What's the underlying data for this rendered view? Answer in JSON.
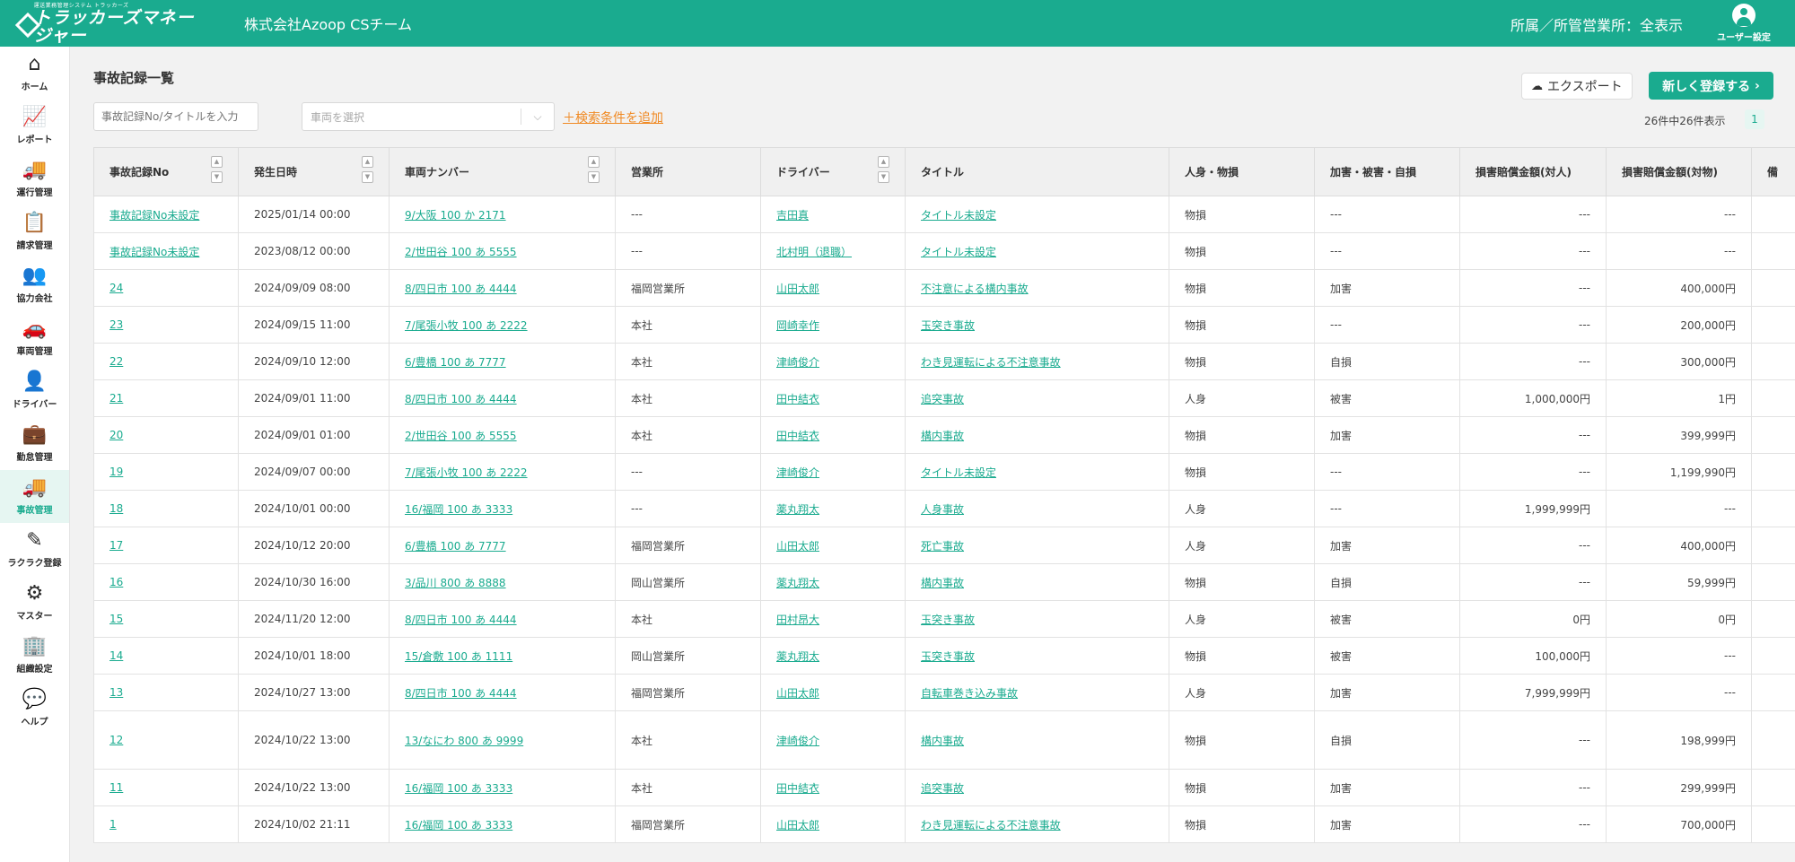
{
  "header": {
    "logo_tag": "運送業務管理システム トラッカーズ",
    "logo_name": "トラッカーズマネージャー",
    "company": "株式会社Azoop CSチーム",
    "affiliation": "所属／所管営業所：全表示",
    "user_settings": "ユーザー設定"
  },
  "sidebar": {
    "items": [
      {
        "label": "ホーム",
        "icon": "⌂",
        "icon_name": "home-icon"
      },
      {
        "label": "レポート",
        "icon": "📈",
        "icon_name": "chart-line-icon"
      },
      {
        "label": "運行管理",
        "icon": "🚚",
        "icon_name": "truck-icon"
      },
      {
        "label": "請求管理",
        "icon": "📋",
        "icon_name": "clipboard-icon"
      },
      {
        "label": "協力会社",
        "icon": "👥",
        "icon_name": "people-icon"
      },
      {
        "label": "車両管理",
        "icon": "🚗",
        "icon_name": "car-icon"
      },
      {
        "label": "ドライバー",
        "icon": "👤",
        "icon_name": "person-icon"
      },
      {
        "label": "勤怠管理",
        "icon": "💼",
        "icon_name": "briefcase-clock-icon"
      },
      {
        "label": "事故管理",
        "icon": "🚚",
        "icon_name": "truck-accident-icon",
        "active": true
      },
      {
        "label": "ラクラク登録",
        "icon": "✎",
        "icon_name": "pencil-icon"
      },
      {
        "label": "マスター",
        "icon": "⚙",
        "icon_name": "gear-icon"
      },
      {
        "label": "組織設定",
        "icon": "🏢",
        "icon_name": "building-icon"
      },
      {
        "label": "ヘルプ",
        "icon": "💬",
        "icon_name": "chat-icon"
      }
    ]
  },
  "main": {
    "title": "事故記録一覧",
    "search_placeholder": "事故記録No/タイトルを入力",
    "vehicle_placeholder": "車両を選択",
    "add_condition": "＋検索条件を追加",
    "export_label": "エクスポート",
    "register_label": "新しく登録する",
    "count_text": "26件中26件表示",
    "page": "1"
  },
  "table": {
    "headers": [
      "事故記録No",
      "発生日時",
      "車両ナンバー",
      "営業所",
      "ドライバー",
      "タイトル",
      "人身・物損",
      "加害・被害・自損",
      "損害賠償金額(対人)",
      "損害賠償金額(対物)",
      "備"
    ],
    "rows": [
      {
        "no": "事故記録No未設定",
        "date": "2025/01/14 00:00",
        "vehicle": "9/大阪 100 か 2171",
        "office": "---",
        "driver": "吉田真",
        "title": "タイトル未設定",
        "kind": "物損",
        "party": "---",
        "personal": "---",
        "property": "---"
      },
      {
        "no": "事故記録No未設定",
        "date": "2023/08/12 00:00",
        "vehicle": "2/世田谷 100 あ 5555",
        "office": "---",
        "driver": "北村明（退職）",
        "title": "タイトル未設定",
        "kind": "物損",
        "party": "---",
        "personal": "---",
        "property": "---"
      },
      {
        "no": "24",
        "date": "2024/09/09 08:00",
        "vehicle": "8/四日市 100 あ 4444",
        "office": "福岡営業所",
        "driver": "山田太郎",
        "title": "不注意による構内事故",
        "kind": "物損",
        "party": "加害",
        "personal": "---",
        "property": "400,000円"
      },
      {
        "no": "23",
        "date": "2024/09/15 11:00",
        "vehicle": "7/尾張小牧 100 あ 2222",
        "office": "本社",
        "driver": "岡崎幸作",
        "title": "玉突き事故",
        "kind": "物損",
        "party": "---",
        "personal": "---",
        "property": "200,000円"
      },
      {
        "no": "22",
        "date": "2024/09/10 12:00",
        "vehicle": "6/豊橋 100 あ 7777",
        "office": "本社",
        "driver": "津崎俊介",
        "title": "わき見運転による不注意事故",
        "kind": "物損",
        "party": "自損",
        "personal": "---",
        "property": "300,000円"
      },
      {
        "no": "21",
        "date": "2024/09/01 11:00",
        "vehicle": "8/四日市 100 あ 4444",
        "office": "本社",
        "driver": "田中結衣",
        "title": "追突事故",
        "kind": "人身",
        "party": "被害",
        "personal": "1,000,000円",
        "property": "1円"
      },
      {
        "no": "20",
        "date": "2024/09/01 01:00",
        "vehicle": "2/世田谷 100 あ 5555",
        "office": "本社",
        "driver": "田中結衣",
        "title": "構内事故",
        "kind": "物損",
        "party": "加害",
        "personal": "---",
        "property": "399,999円"
      },
      {
        "no": "19",
        "date": "2024/09/07 00:00",
        "vehicle": "7/尾張小牧 100 あ 2222",
        "office": "---",
        "driver": "津崎俊介",
        "title": "タイトル未設定",
        "kind": "物損",
        "party": "---",
        "personal": "---",
        "property": "1,199,990円"
      },
      {
        "no": "18",
        "date": "2024/10/01 00:00",
        "vehicle": "16/福岡 100 あ 3333",
        "office": "---",
        "driver": "薬丸翔太",
        "title": "人身事故",
        "kind": "人身",
        "party": "---",
        "personal": "1,999,999円",
        "property": "---"
      },
      {
        "no": "17",
        "date": "2024/10/12 20:00",
        "vehicle": "6/豊橋 100 あ 7777",
        "office": "福岡営業所",
        "driver": "山田太郎",
        "title": "死亡事故",
        "kind": "人身",
        "party": "加害",
        "personal": "---",
        "property": "400,000円"
      },
      {
        "no": "16",
        "date": "2024/10/30 16:00",
        "vehicle": "3/品川 800 あ 8888",
        "office": "岡山営業所",
        "driver": "薬丸翔太",
        "title": "構内事故",
        "kind": "物損",
        "party": "自損",
        "personal": "---",
        "property": "59,999円"
      },
      {
        "no": "15",
        "date": "2024/11/20 12:00",
        "vehicle": "8/四日市 100 あ 4444",
        "office": "本社",
        "driver": "田村昂大",
        "title": "玉突き事故",
        "kind": "人身",
        "party": "被害",
        "personal": "0円",
        "property": "0円"
      },
      {
        "no": "14",
        "date": "2024/10/01 18:00",
        "vehicle": "15/倉敷 100 あ 1111",
        "office": "岡山営業所",
        "driver": "薬丸翔太",
        "title": "玉突き事故",
        "kind": "物損",
        "party": "被害",
        "personal": "100,000円",
        "property": "---"
      },
      {
        "no": "13",
        "date": "2024/10/27 13:00",
        "vehicle": "8/四日市 100 あ 4444",
        "office": "福岡営業所",
        "driver": "山田太郎",
        "title": "自転車巻き込み事故",
        "kind": "人身",
        "party": "加害",
        "personal": "7,999,999円",
        "property": "---"
      },
      {
        "no": "12",
        "date": "2024/10/22 13:00",
        "vehicle": "13/なにわ 800 あ 9999",
        "office": "本社",
        "driver": "津崎俊介",
        "title": "構内事故",
        "kind": "物損",
        "party": "自損",
        "personal": "---",
        "property": "198,999円",
        "tall": true
      },
      {
        "no": "11",
        "date": "2024/10/22 13:00",
        "vehicle": "16/福岡 100 あ 3333",
        "office": "本社",
        "driver": "田中結衣",
        "title": "追突事故",
        "kind": "物損",
        "party": "加害",
        "personal": "---",
        "property": "299,999円"
      },
      {
        "no": "1",
        "date": "2024/10/02 21:11",
        "vehicle": "16/福岡 100 あ 3333",
        "office": "福岡営業所",
        "driver": "山田太郎",
        "title": "わき見運転による不注意事故",
        "kind": "物損",
        "party": "加害",
        "personal": "---",
        "property": "700,000円"
      }
    ]
  }
}
